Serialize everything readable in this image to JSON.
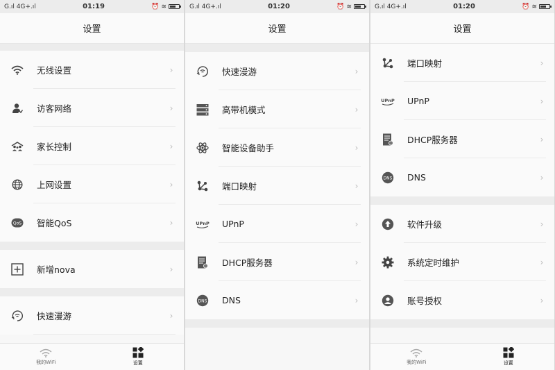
{
  "status": {
    "left": "G.ıl 4G+.ıl",
    "times": [
      "01:19",
      "01:20",
      "01:20"
    ]
  },
  "page_title": "设置",
  "screens": [
    {
      "items": [
        {
          "label": "无线设置",
          "icon": "wifi-icon"
        },
        {
          "label": "访客网络",
          "icon": "guest-user-icon"
        },
        {
          "label": "家长控制",
          "icon": "family-icon"
        },
        {
          "label": "上网设置",
          "icon": "globe-icon"
        },
        {
          "label": "智能QoS",
          "icon": "qos-icon"
        },
        {
          "label": "新增nova",
          "icon": "add-box-icon"
        },
        {
          "label": "快速漫游",
          "icon": "roaming-icon"
        }
      ]
    },
    {
      "items": [
        {
          "label": "快速漫游",
          "icon": "roaming-icon"
        },
        {
          "label": "高带机模式",
          "icon": "server-icon"
        },
        {
          "label": "智能设备助手",
          "icon": "atom-icon"
        },
        {
          "label": "端口映射",
          "icon": "port-mapping-icon"
        },
        {
          "label": "UPnP",
          "icon": "upnp-icon"
        },
        {
          "label": "DHCP服务器",
          "icon": "dhcp-icon"
        },
        {
          "label": "DNS",
          "icon": "dns-icon"
        }
      ]
    },
    {
      "items": [
        {
          "label": "端口映射",
          "icon": "port-mapping-icon"
        },
        {
          "label": "UPnP",
          "icon": "upnp-icon"
        },
        {
          "label": "DHCP服务器",
          "icon": "dhcp-icon"
        },
        {
          "label": "DNS",
          "icon": "dns-icon"
        },
        {
          "label": "软件升级",
          "icon": "upgrade-icon"
        },
        {
          "label": "系统定时维护",
          "icon": "gear-icon"
        },
        {
          "label": "账号授权",
          "icon": "account-icon"
        }
      ]
    }
  ],
  "tabbar": {
    "wifi_label": "我的WiFi",
    "settings_label": "设置"
  },
  "icon_glyphs": {
    "upnp": "UPnP",
    "dns": "DNS",
    "qos": "QoS"
  }
}
